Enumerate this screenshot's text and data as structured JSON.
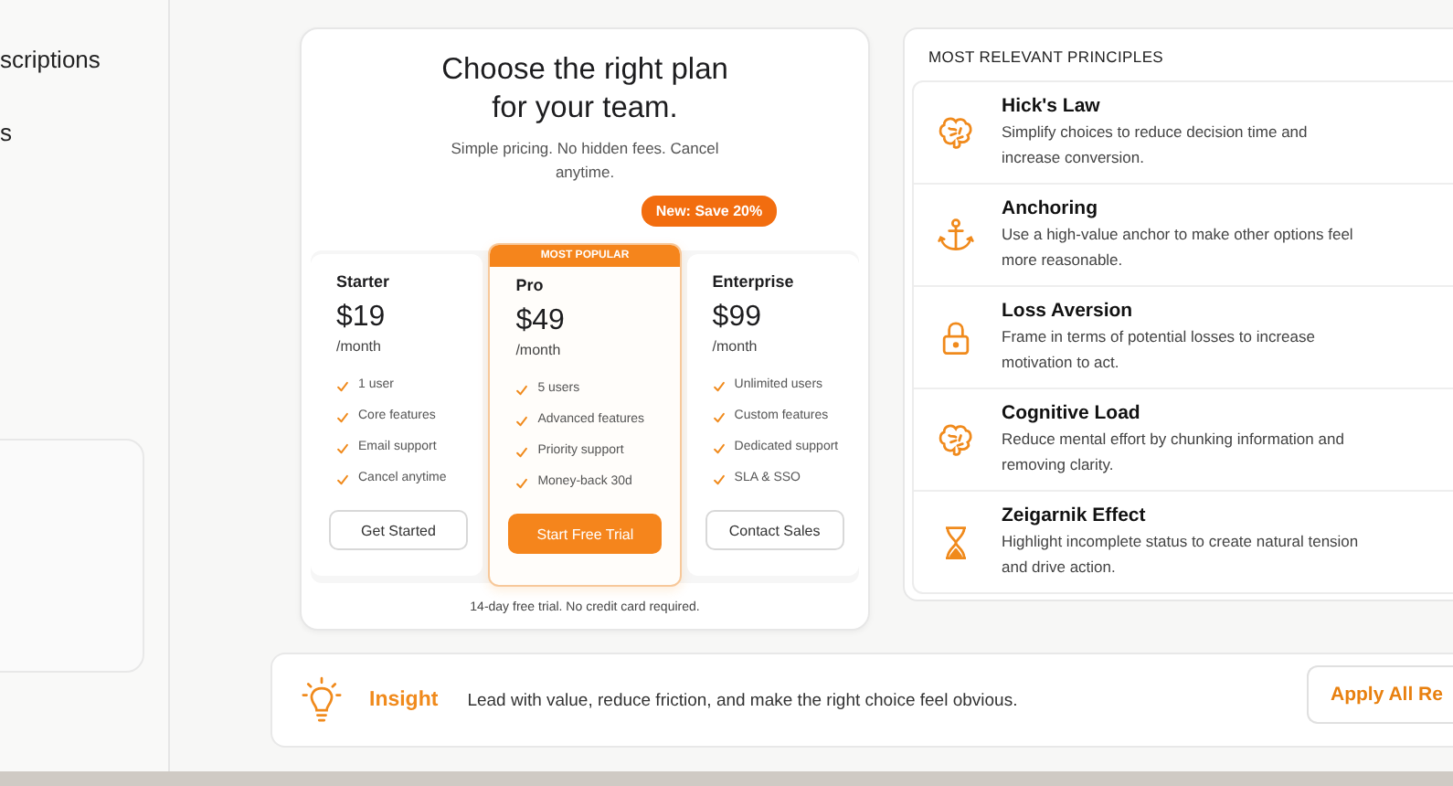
{
  "sidebar": {
    "items": [
      {
        "label": "scriptions"
      },
      {
        "label": "s"
      }
    ]
  },
  "pricing": {
    "title": "Choose the right plan for your team.",
    "subtitle": "Simple pricing. No hidden fees. Cancel anytime.",
    "promo": "New: Save 20%",
    "plans": [
      {
        "name": "Starter",
        "price": "$19",
        "period": "/month",
        "selected": false,
        "features": [
          "1 user",
          "Core features",
          "Email support",
          "Cancel anytime"
        ],
        "button": "Get Started"
      },
      {
        "name": "Pro",
        "badge": "MOST POPULAR",
        "price": "$49",
        "period": "/month",
        "selected": true,
        "features": [
          "5 users",
          "Advanced features",
          "Priority support",
          "Money-back 30d"
        ],
        "button": "Start Free Trial"
      },
      {
        "name": "Enterprise",
        "price": "$99",
        "period": "/month",
        "selected": false,
        "features": [
          "Unlimited users",
          "Custom features",
          "Dedicated support",
          "SLA & SSO"
        ],
        "button": "Contact Sales"
      }
    ],
    "footnote": "14-day free trial. No credit card required."
  },
  "principles": {
    "title": "MOST RELEVANT PRINCIPLES",
    "items": [
      {
        "kind": "brain",
        "name": "Hick's Law",
        "description": "Simplify choices to reduce decision time and increase conversion."
      },
      {
        "kind": "anchor",
        "name": "Anchoring",
        "description": "Use a high-value anchor to make other options feel more reasonable."
      },
      {
        "kind": "lock",
        "name": "Loss Aversion",
        "description": "Frame in terms of potential losses to increase motivation to act."
      },
      {
        "kind": "brain",
        "name": "Cognitive Load",
        "description": "Reduce mental effort by chunking information and removing clarity."
      },
      {
        "kind": "hourglass",
        "name": "Zeigarnik Effect",
        "description": "Highlight incomplete status to create natural tension and drive action."
      }
    ]
  },
  "insight": {
    "label": "Insight",
    "text": "Lead with value, reduce friction, and make the right choice feel obvious.",
    "button": "Apply All Re"
  }
}
